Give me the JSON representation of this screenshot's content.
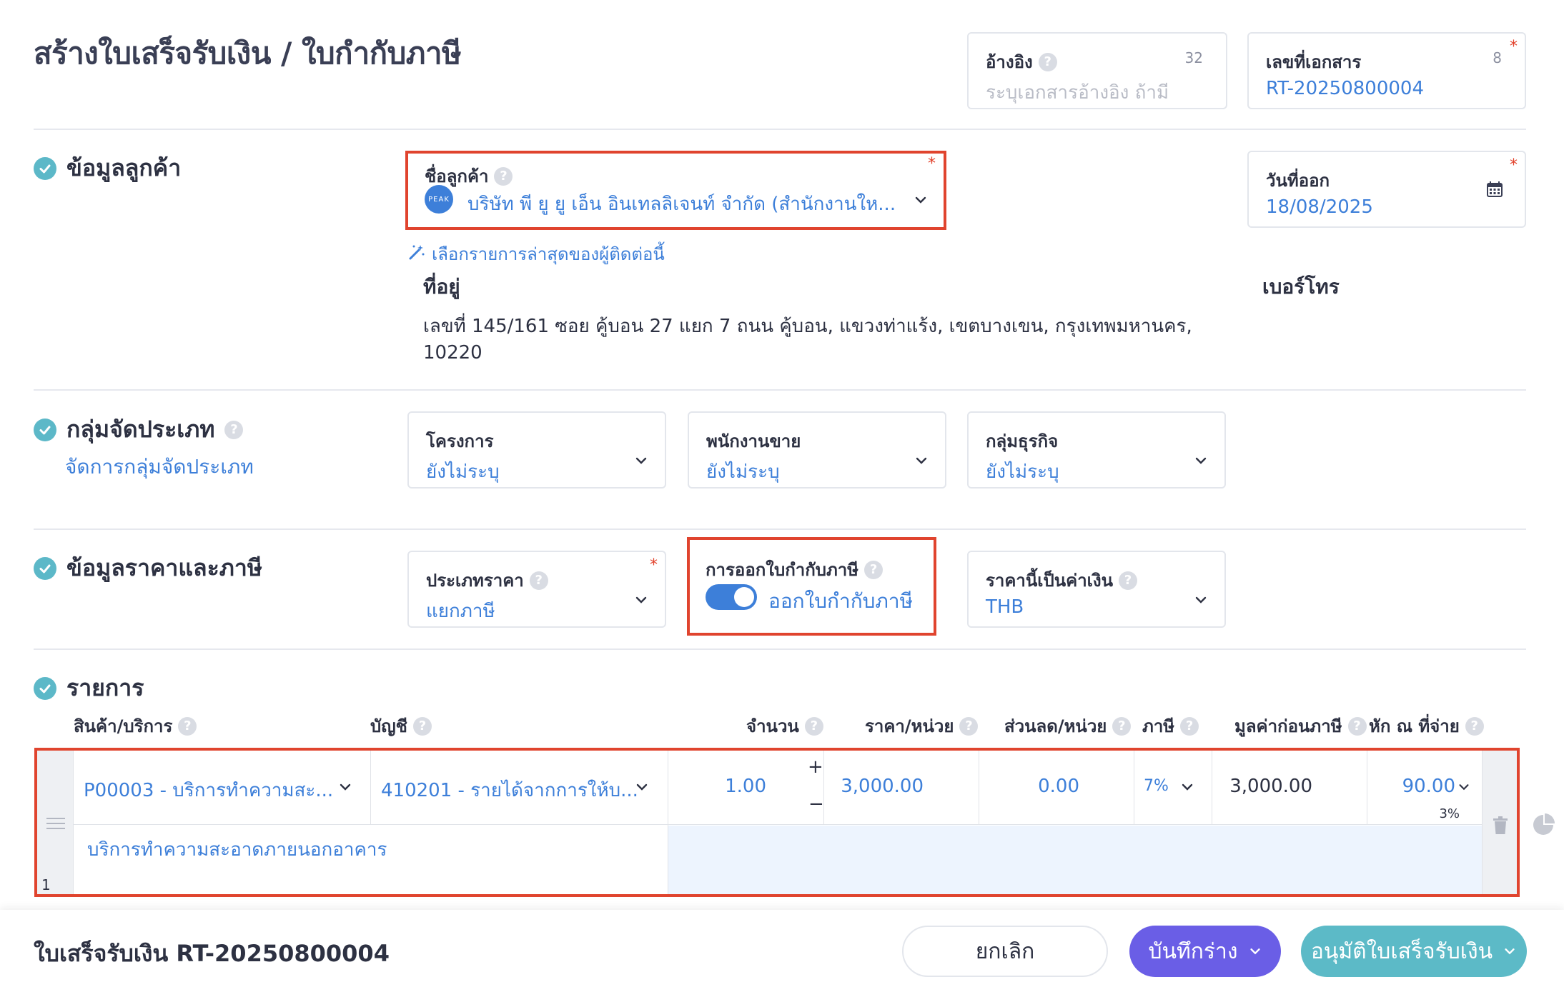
{
  "page": {
    "title": "สร้างใบเสร็จรับเงิน / ใบกำกับภาษี"
  },
  "reference": {
    "label": "อ้างอิง",
    "counter": "32",
    "placeholder": "ระบุเอกสารอ้างอิง ถ้ามี"
  },
  "doc_number": {
    "label": "เลขที่เอกสาร",
    "counter": "8",
    "value": "RT-20250800004"
  },
  "customer_section": {
    "title": "ข้อมูลลูกค้า",
    "customer_label": "ชื่อลูกค้า",
    "customer_logo": "PEAK",
    "customer_value": "บริษัท พี ยู ยู เอ็น อินเทลลิเจนท์ จำกัด (สำนักงานให...",
    "recent_link": "เลือกรายการล่าสุดของผู้ติดต่อนี้",
    "address_label": "ที่อยู่",
    "address_line1": "เลขที่ 145/161 ซอย คู้บอน 27 แยก 7 ถนน คู้บอน, แขวงท่าแร้ง, เขตบางเขน, กรุงเทพมหานคร,",
    "address_line2": "10220",
    "phone_label": "เบอร์โทร",
    "issue_date_label": "วันที่ออก",
    "issue_date_value": "18/08/2025"
  },
  "category_section": {
    "title": "กลุ่มจัดประเภท",
    "manage_link": "จัดการกลุ่มจัดประเภท",
    "project_label": "โครงการ",
    "project_value": "ยังไม่ระบุ",
    "sales_label": "พนักงานขาย",
    "sales_value": "ยังไม่ระบุ",
    "business_label": "กลุ่มธุรกิจ",
    "business_value": "ยังไม่ระบุ"
  },
  "price_section": {
    "title": "ข้อมูลราคาและภาษี",
    "price_type_label": "ประเภทราคา",
    "price_type_value": "แยกภาษี",
    "tax_invoice_label": "การออกใบกำกับภาษี",
    "tax_invoice_toggle_text": "ออกใบกำกับภาษี",
    "tax_invoice_on": true,
    "currency_label": "ราคานี้เป็นค่าเงิน",
    "currency_value": "THB"
  },
  "items_section": {
    "title": "รายการ",
    "columns": {
      "product": "สินค้า/บริการ",
      "account": "บัญชี",
      "qty": "จำนวน",
      "unit_price": "ราคา/หน่วย",
      "discount": "ส่วนลด/หน่วย",
      "tax": "ภาษี",
      "pre_tax": "มูลค่าก่อนภาษี",
      "wht": "หัก ณ ที่จ่าย"
    },
    "rows": [
      {
        "index": "1",
        "product": "P00003 - บริการทำความสะ...",
        "account": "410201 - รายได้จากการให้บ...",
        "qty": "1.00",
        "unit_price": "3,000.00",
        "discount": "0.00",
        "tax": "7%",
        "pre_tax": "3,000.00",
        "wht": "90.00",
        "wht_rate": "3%",
        "description": "บริการทำความสะอาดภายนอกอาคาร"
      }
    ]
  },
  "footer": {
    "doc_title": "ใบเสร็จรับเงิน RT-20250800004",
    "cancel": "ยกเลิก",
    "save_draft": "บันทึกร่าง",
    "approve": "อนุมัติใบเสร็จรับเงิน"
  },
  "colors": {
    "accent_blue": "#3d7fd9",
    "check_teal": "#5cb8c8",
    "draft_purple": "#6a5ee6",
    "approve_teal": "#5cbac7",
    "highlight_red": "#e0442e"
  }
}
